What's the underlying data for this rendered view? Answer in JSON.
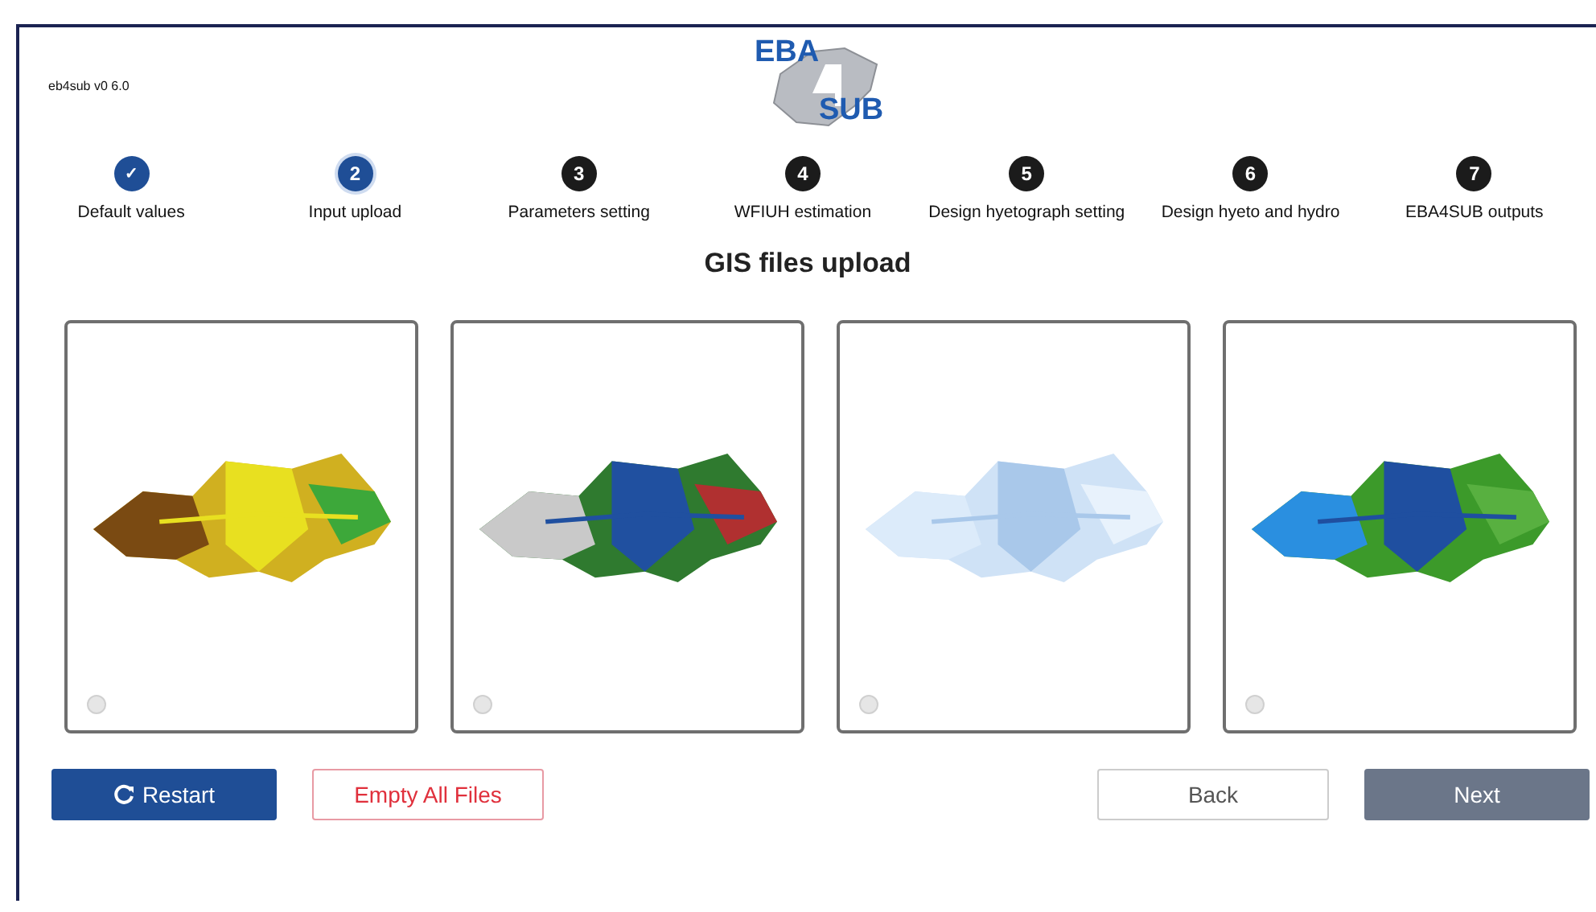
{
  "app": {
    "version": "eb4sub v0 6.0",
    "logo": {
      "top": "EBA",
      "bottom": "SUB"
    }
  },
  "steps": [
    {
      "marker": "✓",
      "label": "Default values",
      "completed": true,
      "selected": false
    },
    {
      "marker": "2",
      "label": "Input upload",
      "completed": false,
      "selected": true
    },
    {
      "marker": "3",
      "label": "Parameters setting",
      "completed": false,
      "selected": false
    },
    {
      "marker": "4",
      "label": "WFIUH estimation",
      "completed": false,
      "selected": false
    },
    {
      "marker": "5",
      "label": "Design hyetograph setting",
      "completed": false,
      "selected": false
    },
    {
      "marker": "6",
      "label": "Design hyeto and hydro",
      "completed": false,
      "selected": false
    },
    {
      "marker": "7",
      "label": "EBA4SUB outputs",
      "completed": false,
      "selected": false
    }
  ],
  "section_title": "GIS files upload",
  "buttons": [
    {
      "kind": "primary",
      "label": "Restart"
    },
    {
      "kind": "danger-outline",
      "label": "Empty All Files"
    },
    {
      "kind": "outline",
      "label": "Back"
    },
    {
      "kind": "secondary",
      "label": "Next"
    }
  ]
}
